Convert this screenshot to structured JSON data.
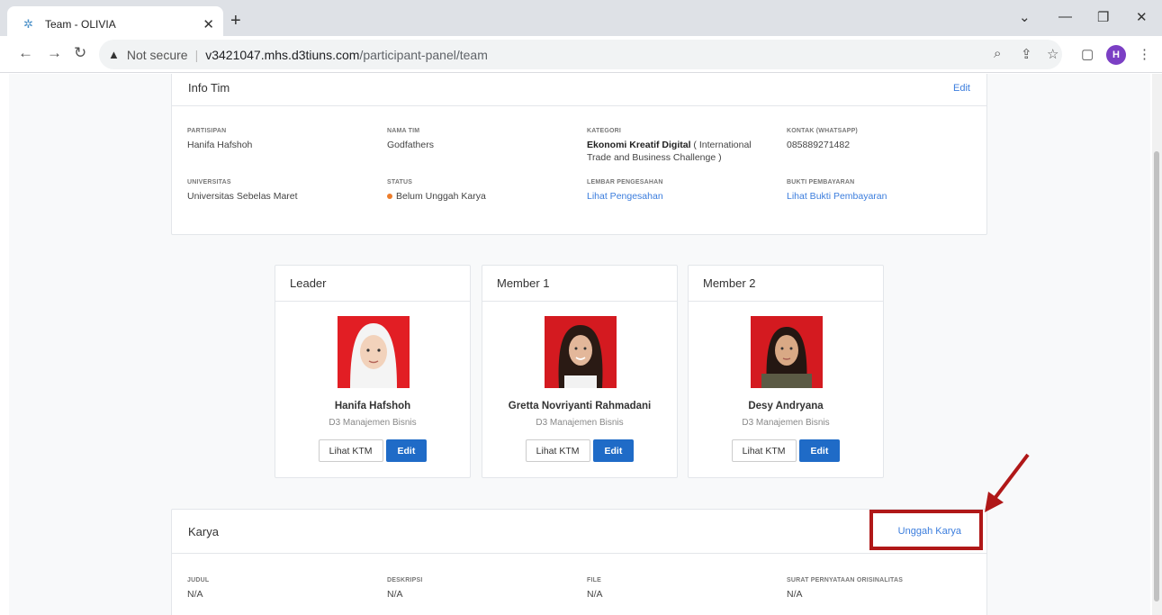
{
  "browser": {
    "tab_title": "Team - OLIVIA",
    "not_secure": "Not secure",
    "url_host": "v3421047.mhs.d3tiuns.com",
    "url_path": "/participant-panel/team",
    "profile_initial": "H"
  },
  "info_tim": {
    "title": "Info Tim",
    "edit": "Edit",
    "fields": {
      "partisipan_label": "PARTISIPAN",
      "partisipan": "Hanifa Hafshoh",
      "nama_tim_label": "NAMA TIM",
      "nama_tim": "Godfathers",
      "kategori_label": "KATEGORI",
      "kategori_bold": "Ekonomi Kreatif Digital",
      "kategori_rest": " ( International Trade and Business Challenge )",
      "kontak_label": "KONTAK (WHATSAPP)",
      "kontak": "085889271482",
      "universitas_label": "UNIVERSITAS",
      "universitas": "Universitas Sebelas Maret",
      "status_label": "STATUS",
      "status": "Belum Unggah Karya",
      "lembar_label": "LEMBAR PENGESAHAN",
      "lembar_link": "Lihat Pengesahan",
      "bukti_label": "BUKTI PEMBAYARAN",
      "bukti_link": "Lihat Bukti Pembayaran"
    }
  },
  "members": [
    {
      "role": "Leader",
      "name": "Hanifa Hafshoh",
      "program": "D3 Manajemen Bisnis",
      "ktm": "Lihat KTM",
      "edit": "Edit"
    },
    {
      "role": "Member 1",
      "name": "Gretta Novriyanti Rahmadani",
      "program": "D3 Manajemen Bisnis",
      "ktm": "Lihat KTM",
      "edit": "Edit"
    },
    {
      "role": "Member 2",
      "name": "Desy Andryana",
      "program": "D3 Manajemen Bisnis",
      "ktm": "Lihat KTM",
      "edit": "Edit"
    }
  ],
  "karya": {
    "title": "Karya",
    "upload": "Unggah Karya",
    "judul_label": "JUDUL",
    "judul": "N/A",
    "deskripsi_label": "DESKRIPSI",
    "deskripsi": "N/A",
    "file_label": "FILE",
    "file": "N/A",
    "surat_label": "SURAT PERNYATAAN ORISINALITAS",
    "surat": "N/A"
  },
  "colors": {
    "accent": "#1f6bc7",
    "link": "#3b7ddd",
    "status_dot": "#ed7d2b",
    "annotation": "#b01818"
  }
}
